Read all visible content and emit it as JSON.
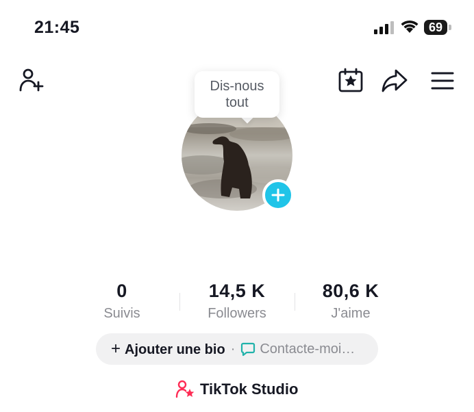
{
  "status_bar": {
    "time": "21:45",
    "battery_level": "69",
    "icons": [
      "signal-icon",
      "wifi-icon",
      "battery-icon"
    ]
  },
  "header": {
    "icons": [
      "add-friend-icon",
      "calendar-star-icon",
      "share-icon",
      "menu-icon"
    ]
  },
  "profile": {
    "tooltip_text_line1": "Dis-nous",
    "tooltip_text_line2": "tout",
    "avatar_description": "dog-photo",
    "add_photo_icon": "plus-icon"
  },
  "stats": [
    {
      "value": "0",
      "label": "Suivis"
    },
    {
      "value": "14,5 K",
      "label": "Followers"
    },
    {
      "value": "80,6 K",
      "label": "J'aime"
    }
  ],
  "bio": {
    "add_label": "Ajouter une bio",
    "separator": "·",
    "contact_label": "Contacte-moi…"
  },
  "studio": {
    "label": "TikTok Studio"
  },
  "colors": {
    "accent_cyan": "#20c4e8",
    "studio_pink": "#fe2c55",
    "contact_green": "#20b2aa",
    "text_primary": "#161823",
    "text_secondary": "#8a8b91"
  }
}
